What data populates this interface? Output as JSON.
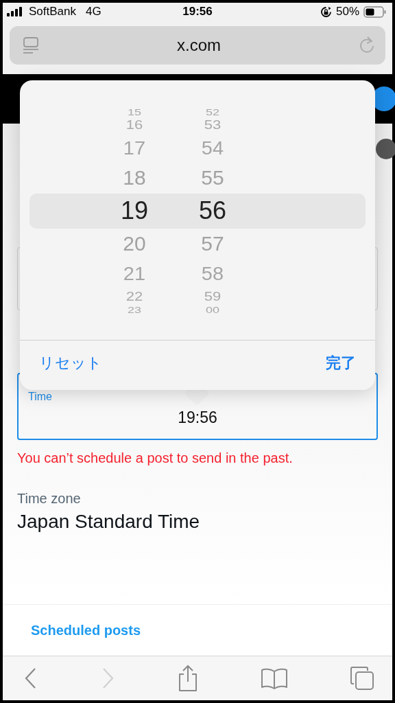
{
  "status_bar": {
    "carrier": "SoftBank",
    "network": "4G",
    "time": "19:56",
    "battery": "50%"
  },
  "address_bar": {
    "url": "x.com"
  },
  "time_picker": {
    "hours": [
      {
        "label": "15",
        "selected": false
      },
      {
        "label": "16",
        "selected": false
      },
      {
        "label": "17",
        "selected": false
      },
      {
        "label": "18",
        "selected": false
      },
      {
        "label": "19",
        "selected": true
      },
      {
        "label": "20",
        "selected": false
      },
      {
        "label": "21",
        "selected": false
      },
      {
        "label": "22",
        "selected": false
      },
      {
        "label": "23",
        "selected": false
      }
    ],
    "minutes": [
      {
        "label": "52",
        "selected": false
      },
      {
        "label": "53",
        "selected": false
      },
      {
        "label": "54",
        "selected": false
      },
      {
        "label": "55",
        "selected": false
      },
      {
        "label": "56",
        "selected": true
      },
      {
        "label": "57",
        "selected": false
      },
      {
        "label": "58",
        "selected": false
      },
      {
        "label": "59",
        "selected": false
      },
      {
        "label": "00",
        "selected": false
      }
    ],
    "reset_button": "リセット",
    "done_button": "完了"
  },
  "form": {
    "time_field": {
      "label": "Time",
      "value": "19:56",
      "focused": true
    },
    "error": "You can’t schedule a post to send in the past.",
    "time_zone": {
      "label": "Time zone",
      "value": "Japan Standard Time"
    }
  },
  "footer_link": "Scheduled posts",
  "toolbar": {
    "back_enabled": true,
    "forward_enabled": false
  }
}
